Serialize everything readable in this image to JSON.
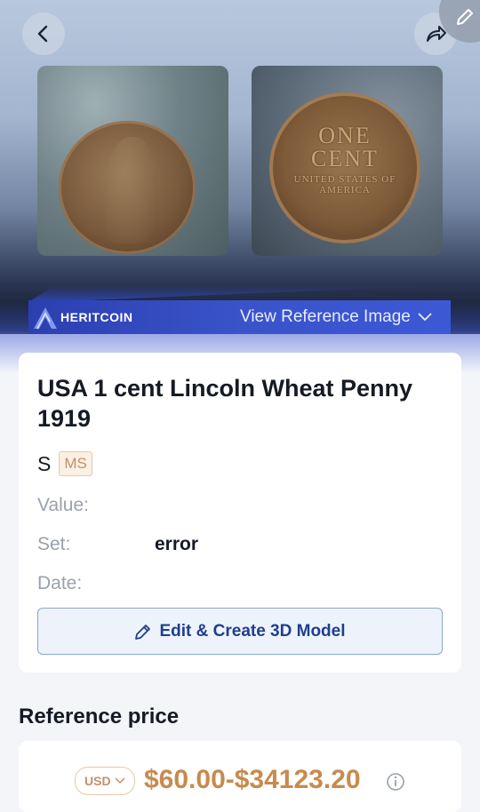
{
  "header": {
    "back_icon": "chevron-left-icon",
    "share_icon": "share-arrow-icon",
    "edit_icon": "pencil-icon"
  },
  "coin_images": {
    "reverse_text": [
      "ONE",
      "CENT",
      "UNITED STATES OF AMERICA"
    ]
  },
  "banner": {
    "brand": "HERITCOIN",
    "view_reference": "View Reference Image"
  },
  "coin": {
    "title": "USA 1 cent  Lincoln Wheat Penny 1919",
    "grade_letter": "S",
    "grade_badge": "MS",
    "value_label": "Value:",
    "value": "",
    "set_label": "Set:",
    "set_value": "error",
    "date_label": "Date:",
    "date_value": ""
  },
  "actions": {
    "edit_3d": "Edit & Create 3D Model"
  },
  "reference": {
    "heading": "Reference price",
    "currency": "USD",
    "price_range": "$60.00-$34123.20"
  },
  "colors": {
    "accent": "#1d3f8f",
    "price": "#c88a4e",
    "banner": "#3a53c9"
  }
}
